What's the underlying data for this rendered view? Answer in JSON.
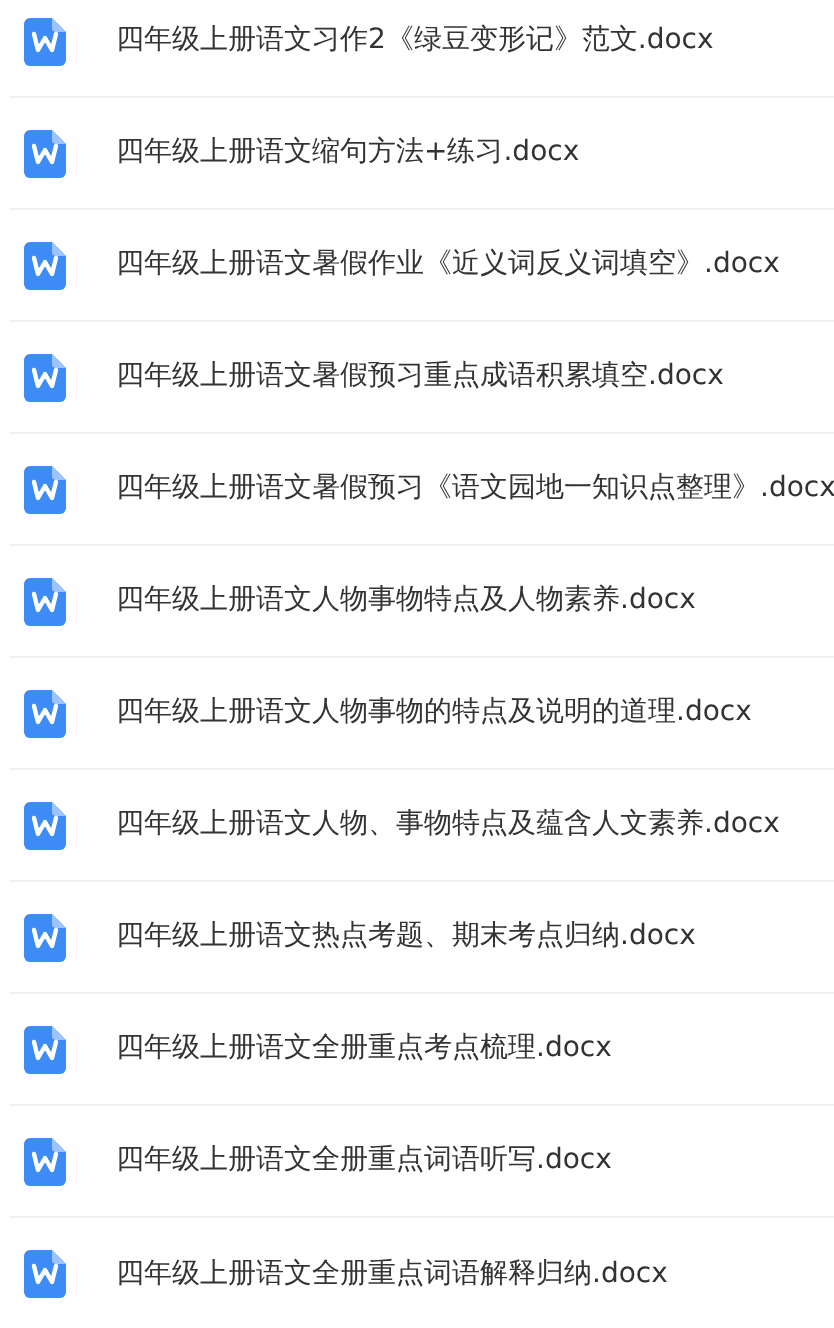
{
  "files": [
    {
      "name": "四年级上册语文习作2《绿豆变形记》范文.docx"
    },
    {
      "name": "四年级上册语文缩句方法+练习.docx"
    },
    {
      "name": "四年级上册语文暑假作业《近义词反义词填空》.docx"
    },
    {
      "name": "四年级上册语文暑假预习重点成语积累填空.docx"
    },
    {
      "name": "四年级上册语文暑假预习《语文园地一知识点整理》.docx"
    },
    {
      "name": "四年级上册语文人物事物特点及人物素养.docx"
    },
    {
      "name": "四年级上册语文人物事物的特点及说明的道理.docx"
    },
    {
      "name": "四年级上册语文人物、事物特点及蕴含人文素养.docx"
    },
    {
      "name": "四年级上册语文热点考题、期末考点归纳.docx"
    },
    {
      "name": "四年级上册语文全册重点考点梳理.docx"
    },
    {
      "name": "四年级上册语文全册重点词语听写.docx"
    },
    {
      "name": "四年级上册语文全册重点词语解释归纳.docx"
    }
  ]
}
